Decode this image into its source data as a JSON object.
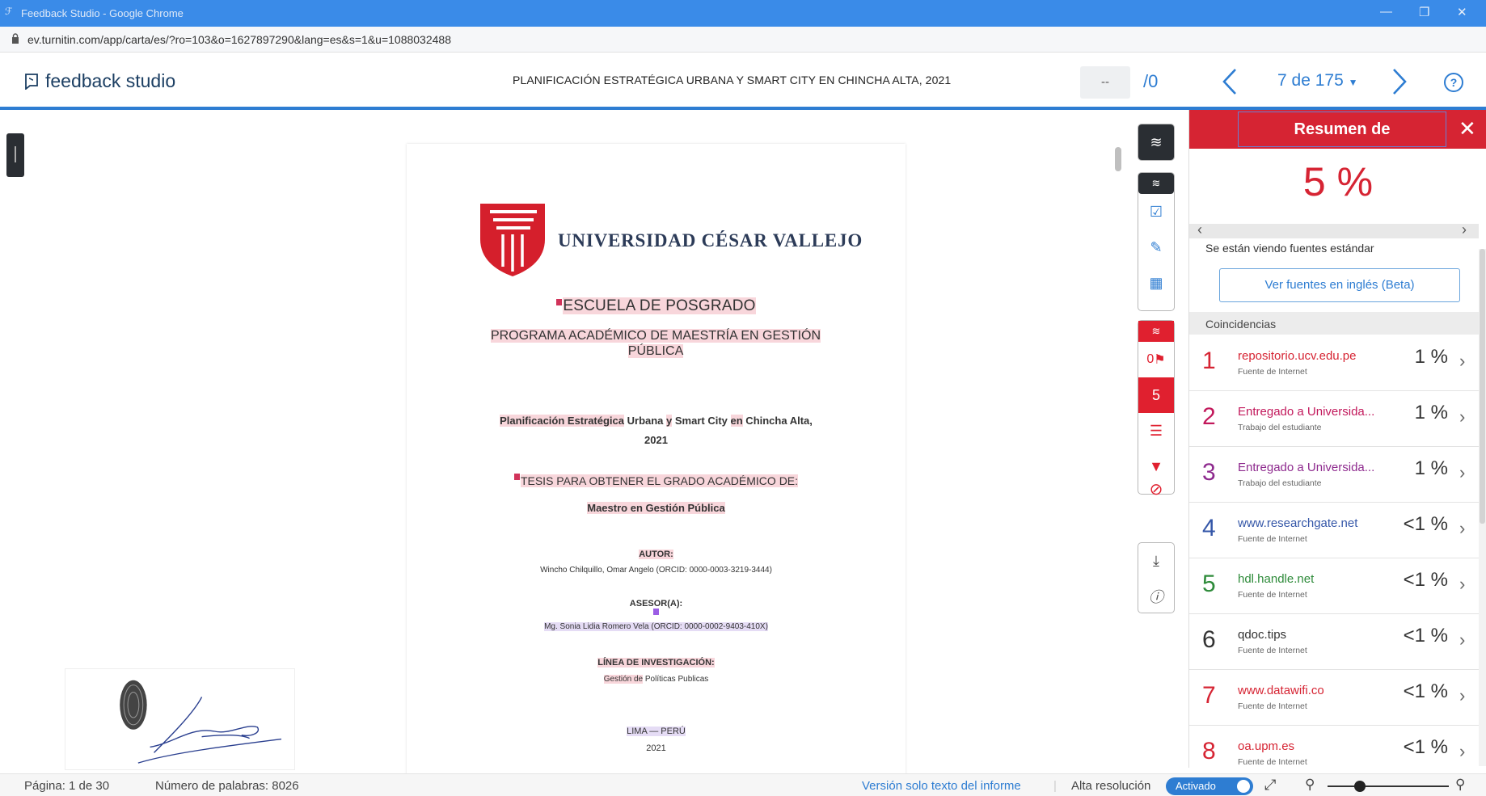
{
  "window": {
    "title": "Feedback Studio - Google Chrome"
  },
  "browser": {
    "url": "ev.turnitin.com/app/carta/es/?ro=103&o=1627897290&lang=es&s=1&u=1088032488"
  },
  "header": {
    "logo": "feedback studio",
    "doc_title": "PLANIFICACIÓN ESTRATÉGICA URBANA Y SMART CITY EN CHINCHA ALTA, 2021",
    "page_input": "--",
    "page_total": "/0",
    "count_label": "7 de 175",
    "help": "?"
  },
  "document": {
    "university": "UNIVERSIDAD CÉSAR VALLEJO",
    "school": "ESCUELA DE POSGRADO",
    "program": "PROGRAMA ACADÉMICO DE MAESTRÍA EN GESTIÓN PÚBLICA",
    "title_parts": [
      "Planificación Estratégica",
      " Urbana ",
      "y",
      " Smart City ",
      "en",
      " Chincha Alta,"
    ],
    "year": "2021",
    "thesis": "TESIS PARA OBTENER EL GRADO ACADÉMICO DE:",
    "degree": "Maestro en Gestión Pública",
    "author_label": "AUTOR:",
    "author": "Wincho Chilquillo, Omar Angelo (ORCID: 0000-0003-3219-3444)",
    "advisor_label": "ASESOR(A):",
    "advisor": "Mg. Sonia Lidia Romero Vela (ORCID: 0000-0002-9403-410X)",
    "line_label": "LÍNEA DE INVESTIGACIÓN:",
    "line": [
      "Gestión de",
      " Políticas Publicas"
    ],
    "city": "LIMA — PERÚ",
    "city_year": "2021"
  },
  "toolbar": {
    "flag_count": "0",
    "match_count": "5"
  },
  "panel": {
    "title": "Resumen de coincidencias",
    "percent": "5 %",
    "standard_note": "Se están viendo fuentes estándar",
    "english_btn": "Ver fuentes en inglés (Beta)",
    "matches_label": "Coincidencias",
    "matches": [
      {
        "n": "1",
        "name": "repositorio.ucv.edu.pe",
        "sub": "Fuente de Internet",
        "pct": "1 %",
        "color": "#d62433"
      },
      {
        "n": "2",
        "name": "Entregado a Universida...",
        "sub": "Trabajo del estudiante",
        "pct": "1 %",
        "color": "#c2185b"
      },
      {
        "n": "3",
        "name": "Entregado a Universida...",
        "sub": "Trabajo del estudiante",
        "pct": "1 %",
        "color": "#8e2a8e"
      },
      {
        "n": "4",
        "name": "www.researchgate.net",
        "sub": "Fuente de Internet",
        "pct": "<1 %",
        "color": "#3557a8"
      },
      {
        "n": "5",
        "name": "hdl.handle.net",
        "sub": "Fuente de Internet",
        "pct": "<1 %",
        "color": "#2e8b3a"
      },
      {
        "n": "6",
        "name": "qdoc.tips",
        "sub": "Fuente de Internet",
        "pct": "<1 %",
        "color": "#333333"
      },
      {
        "n": "7",
        "name": "www.datawifi.co",
        "sub": "Fuente de Internet",
        "pct": "<1 %",
        "color": "#d62433"
      },
      {
        "n": "8",
        "name": "oa.upm.es",
        "sub": "Fuente de Internet",
        "pct": "<1 %",
        "color": "#d62433"
      }
    ]
  },
  "status": {
    "page": "Página: 1 de 30",
    "words": "Número de palabras: 8026",
    "text_only": "Versión solo texto del informe",
    "hires": "Alta resolución",
    "toggle": "Activado"
  }
}
